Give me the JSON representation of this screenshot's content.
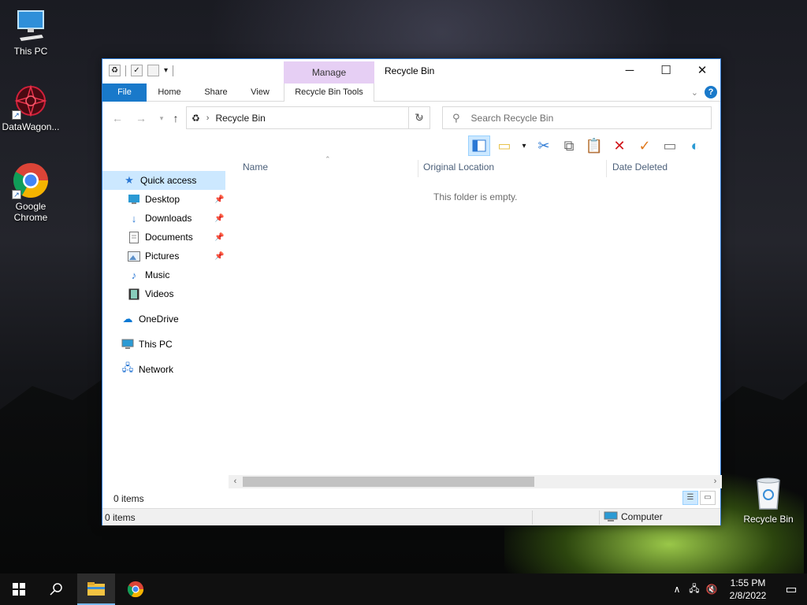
{
  "desktop": {
    "icons": [
      {
        "label": "This PC",
        "icon": "monitor-icon"
      },
      {
        "label": "DataWagon...",
        "icon": "datawagon-icon"
      },
      {
        "label": "Google Chrome",
        "icon": "chrome-icon"
      },
      {
        "label": "Recycle Bin",
        "icon": "recycle-bin-icon"
      }
    ]
  },
  "window": {
    "title": "Recycle Bin",
    "manage_tab": "Manage",
    "tabs": [
      "File",
      "Home",
      "Share",
      "View",
      "Recycle Bin Tools"
    ],
    "address": {
      "location": "Recycle Bin"
    },
    "search": {
      "placeholder": "Search Recycle Bin"
    },
    "controls": {
      "minimize": "─",
      "maximize": "☐",
      "close": "✕"
    }
  },
  "nav_pane": {
    "quick_access": "Quick access",
    "items": [
      {
        "label": "Desktop",
        "pinned": true,
        "icon": "desktop-folder-icon"
      },
      {
        "label": "Downloads",
        "pinned": true,
        "icon": "download-icon"
      },
      {
        "label": "Documents",
        "pinned": true,
        "icon": "documents-icon"
      },
      {
        "label": "Pictures",
        "pinned": true,
        "icon": "pictures-icon"
      },
      {
        "label": "Music",
        "pinned": false,
        "icon": "music-icon"
      },
      {
        "label": "Videos",
        "pinned": false,
        "icon": "videos-icon"
      }
    ],
    "onedrive": "OneDrive",
    "this_pc": "This PC",
    "network": "Network"
  },
  "content": {
    "columns": [
      "Name",
      "Original Location",
      "Date Deleted"
    ],
    "empty_message": "This folder is empty."
  },
  "status": {
    "items_count": "0 items",
    "bottom_items": "0 items",
    "location": "Computer"
  },
  "taskbar": {
    "time": "1:55 PM",
    "date": "2/8/2022"
  },
  "colors": {
    "accent": "#1979ca",
    "manage_tab_bg": "#e6cff4",
    "selection": "#cce8ff"
  }
}
